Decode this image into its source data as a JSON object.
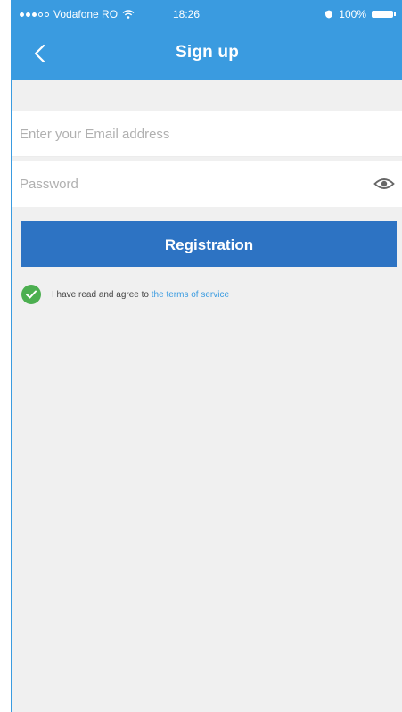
{
  "status_bar": {
    "carrier": "Vodafone RO",
    "time": "18:26",
    "battery_percent": "100%",
    "icons": [
      "signal-dots-icon",
      "wifi-icon",
      "shield-icon",
      "battery-icon"
    ]
  },
  "navbar": {
    "title": "Sign up",
    "back_icon": "chevron-left-icon"
  },
  "form": {
    "email_placeholder": "Enter your Email address",
    "email_value": "",
    "password_placeholder": "Password",
    "password_value": "",
    "eye_icon": "eye-icon"
  },
  "registration_label": "Registration",
  "agreement": {
    "text": "I have read and agree to",
    "link": "the terms of service",
    "checked": true,
    "check_icon": "checkmark-icon"
  },
  "colors": {
    "brand_blue": "#3a9be0",
    "button_blue": "#2d73c3",
    "success_green": "#4caf50",
    "background": "#f0f0f0"
  }
}
